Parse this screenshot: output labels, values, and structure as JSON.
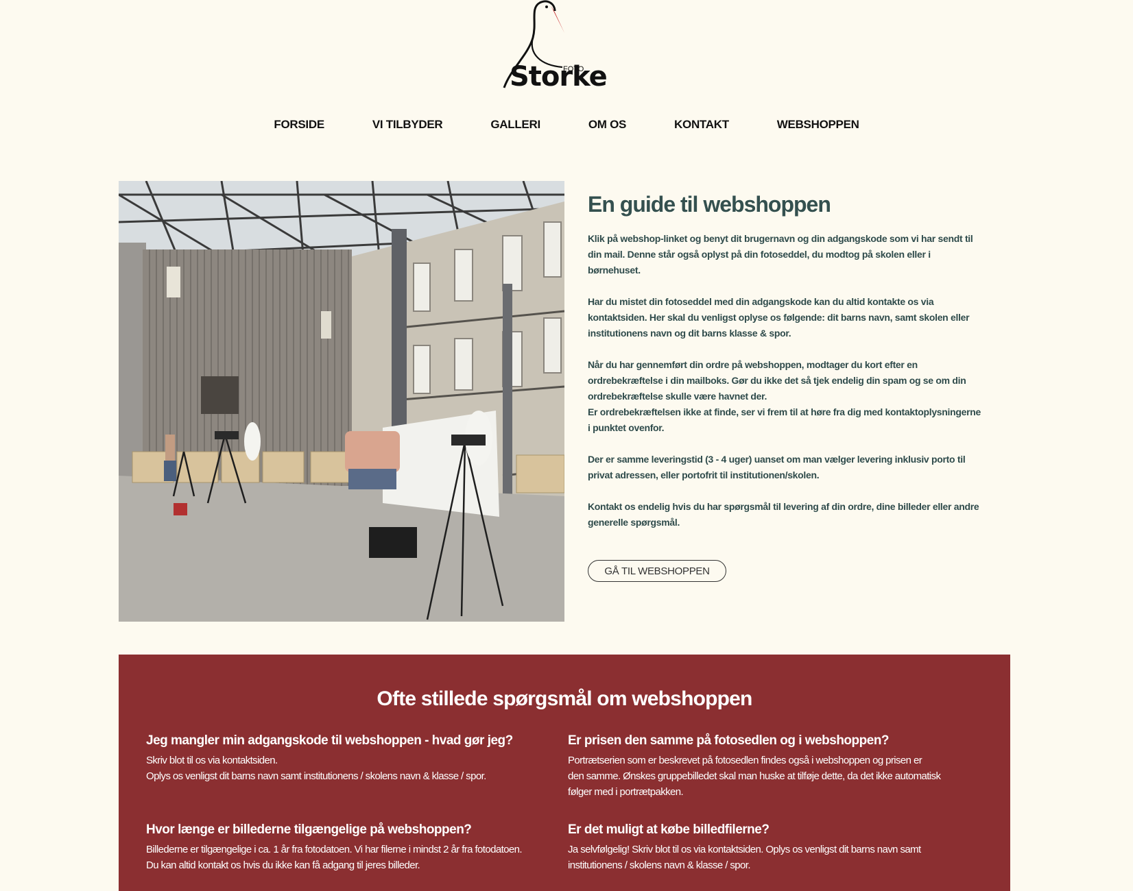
{
  "logo": {
    "word": "Storke",
    "foto": "FOTO"
  },
  "nav": {
    "items": [
      "FORSIDE",
      "VI TILBYDER",
      "GALLERI",
      "OM OS",
      "KONTAKT",
      "WEBSHOPPEN"
    ]
  },
  "guide": {
    "title": "En guide til webshoppen",
    "paragraphs": [
      "Klik på webshop-linket og benyt dit brugernavn og din adgangskode som vi har sendt til din mail. Denne står også oplyst på din fotoseddel, du modtog på skolen eller i børnehuset.",
      "Har du mistet din fotoseddel med din adgangskode kan du altid kontakte os via kontaktsiden. Her skal du venligst oplyse os følgende: dit barns navn, samt skolen eller institutionens navn og dit barns klasse & spor.",
      "Når du har gennemført din ordre på webshoppen, modtager du kort efter en ordrebekræftelse i din mailboks. Gør du ikke det så tjek endelig din spam og se om din ordrebekræftelse skulle være havnet der.",
      "Er ordrebekræftelsen ikke at finde, ser vi frem til at høre fra dig med kontaktoplysningerne i punktet ovenfor.",
      "Der er samme leveringstid (3 - 4 uger) uanset om man vælger levering inklusiv porto til privat adressen, eller portofrit til institutionen/skolen.",
      "Kontakt os endelig hvis du har spørgsmål til levering af din ordre, dine billeder eller andre generelle spørgsmål."
    ],
    "button": "GÅ TIL WEBSHOPPEN"
  },
  "faq": {
    "title": "Ofte stillede spørgsmål om webshoppen",
    "items": [
      {
        "question": "Jeg mangler min adgangskode til webshoppen - hvad gør jeg?",
        "answer_lines": [
          "Skriv blot til os via kontaktsiden.",
          "Oplys os venligst dit barns navn samt institutionens / skolens navn & klasse / spor."
        ]
      },
      {
        "question": "Er prisen den samme på fotosedlen og i webshoppen?",
        "answer_lines": [
          "Portrætserien som er beskrevet på fotosedlen findes også i webshoppen og prisen er",
          "den samme. Ønskes gruppebilledet skal man huske at tilføje dette, da det ikke automatisk",
          "følger med i portrætpakken."
        ]
      },
      {
        "question": "Hvor længe er billederne tilgængelige på webshoppen?",
        "answer_lines": [
          "Billederne er tilgængelige i ca. 1 år fra fotodatoen. Vi har filerne i mindst 2 år fra fotodatoen.",
          "Du kan altid kontakt os hvis du ikke kan få adgang til jeres billeder."
        ]
      },
      {
        "question": "Er det muligt at købe billedfilerne?",
        "answer_lines": [
          "Ja selvfølgelig! Skriv blot til os via kontaktsiden. Oplys os venligst dit barns navn samt",
          "institutionens / skolens navn & klasse / spor."
        ]
      }
    ]
  },
  "colors": {
    "background": "#fdfaf0",
    "accent_red": "#8b2f31",
    "heading_teal": "#34504f"
  }
}
